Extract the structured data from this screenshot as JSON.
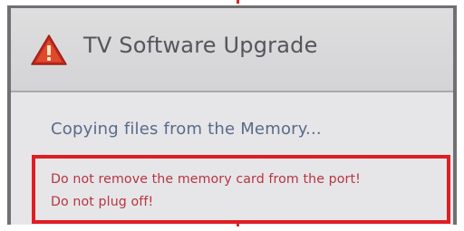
{
  "dialog": {
    "title": "TV Software Upgrade",
    "icon": "warning-triangle-icon",
    "status_text": "Copying files from the Memory...",
    "warning_lines": [
      "Do not remove the memory card from the port!",
      "Do not plug off!"
    ]
  },
  "colors": {
    "warning_border": "#e01d23",
    "warning_text": "#b83440",
    "status_text": "#5a6a8a",
    "title_text": "#55555c",
    "icon_fill": "#c4281e"
  }
}
